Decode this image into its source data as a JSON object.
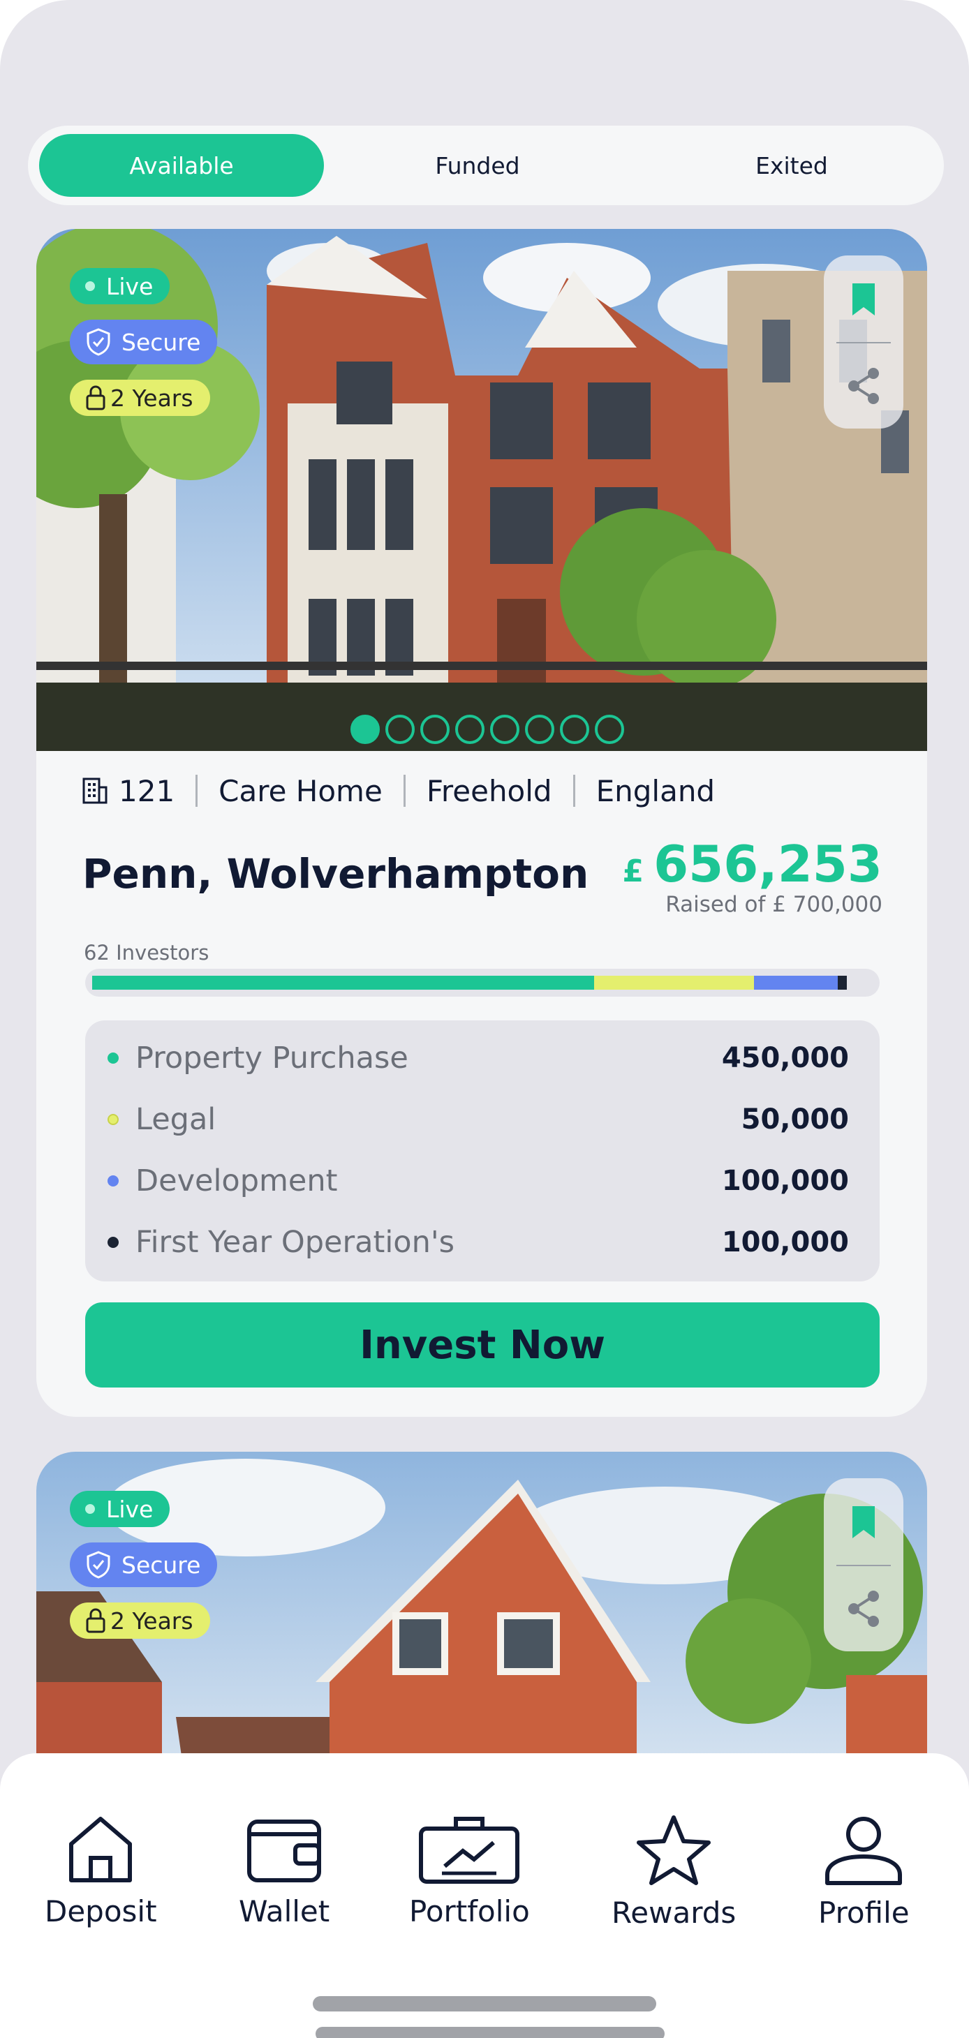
{
  "tabs": [
    {
      "label": "Available",
      "active": true
    },
    {
      "label": "Funded",
      "active": false
    },
    {
      "label": "Exited",
      "active": false
    }
  ],
  "colors": {
    "accent": "#1cc594",
    "secure_badge": "#6384f0",
    "years_badge": "#e4ef6e",
    "text_dark": "#111a33",
    "text_muted": "#6b6f78"
  },
  "listings": [
    {
      "badges": {
        "live": "Live",
        "secure": "Secure",
        "term": "2 Years"
      },
      "icons": {
        "save": "bookmark-icon",
        "share": "share-icon"
      },
      "gallery": {
        "count": 8,
        "current": 1
      },
      "meta": {
        "units": "121",
        "type": "Care Home",
        "tenure": "Freehold",
        "region": "England"
      },
      "title": "Penn, Wolverhampton",
      "raised": {
        "currency": "£",
        "amount": "656,253",
        "target_text": "Raised of £ 700,000"
      },
      "investors_text": "62 Investors",
      "allocation": [
        {
          "label": "Property Purchase",
          "value": "450,000",
          "color": "#1cc594",
          "fraction": 0.643
        },
        {
          "label": "Legal",
          "value": "50,000",
          "color": "#e4ef6e",
          "fraction": 0.205
        },
        {
          "label": "Development",
          "value": "100,000",
          "color": "#6384f0",
          "fraction": 0.107
        },
        {
          "label": "First Year Operation's",
          "value": "100,000",
          "color": "#1b2333",
          "fraction": 0.012
        }
      ],
      "cta": "Invest Now"
    },
    {
      "badges": {
        "live": "Live",
        "secure": "Secure",
        "term": "2 Years"
      },
      "icons": {
        "save": "bookmark-icon",
        "share": "share-icon"
      }
    }
  ],
  "nav": [
    {
      "label": "Deposit",
      "icon": "home-icon"
    },
    {
      "label": "Wallet",
      "icon": "wallet-icon"
    },
    {
      "label": "Portfolio",
      "icon": "briefcase-chart-icon"
    },
    {
      "label": "Rewards",
      "icon": "star-icon"
    },
    {
      "label": "Profile",
      "icon": "person-icon"
    }
  ]
}
